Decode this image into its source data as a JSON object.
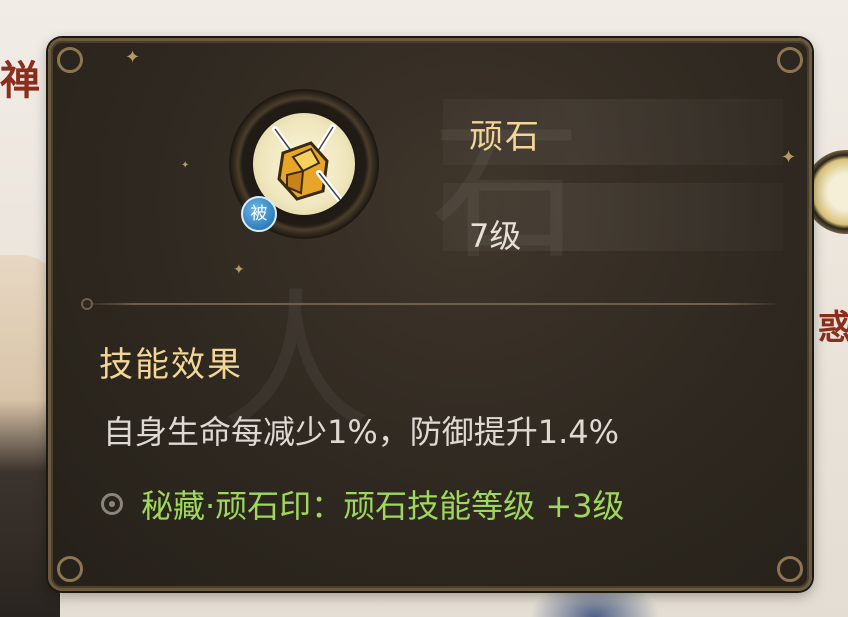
{
  "background": {
    "left_char": "禅",
    "right_char": "惑"
  },
  "tooltip": {
    "skill_name": "顽石",
    "skill_level": "7级",
    "passive_badge": "被",
    "section_title": "技能效果",
    "effect_description": "自身生命每减少1%，防御提升1.4%",
    "bonus_text": "秘藏·顽石印：顽石技能等级 +3级",
    "icon": "golden-rock-skill-icon"
  },
  "colors": {
    "title_gold": "#f3d596",
    "bonus_green": "#9ed85a",
    "panel_bg": "#2e2820",
    "badge_blue": "#2f7fbd"
  }
}
